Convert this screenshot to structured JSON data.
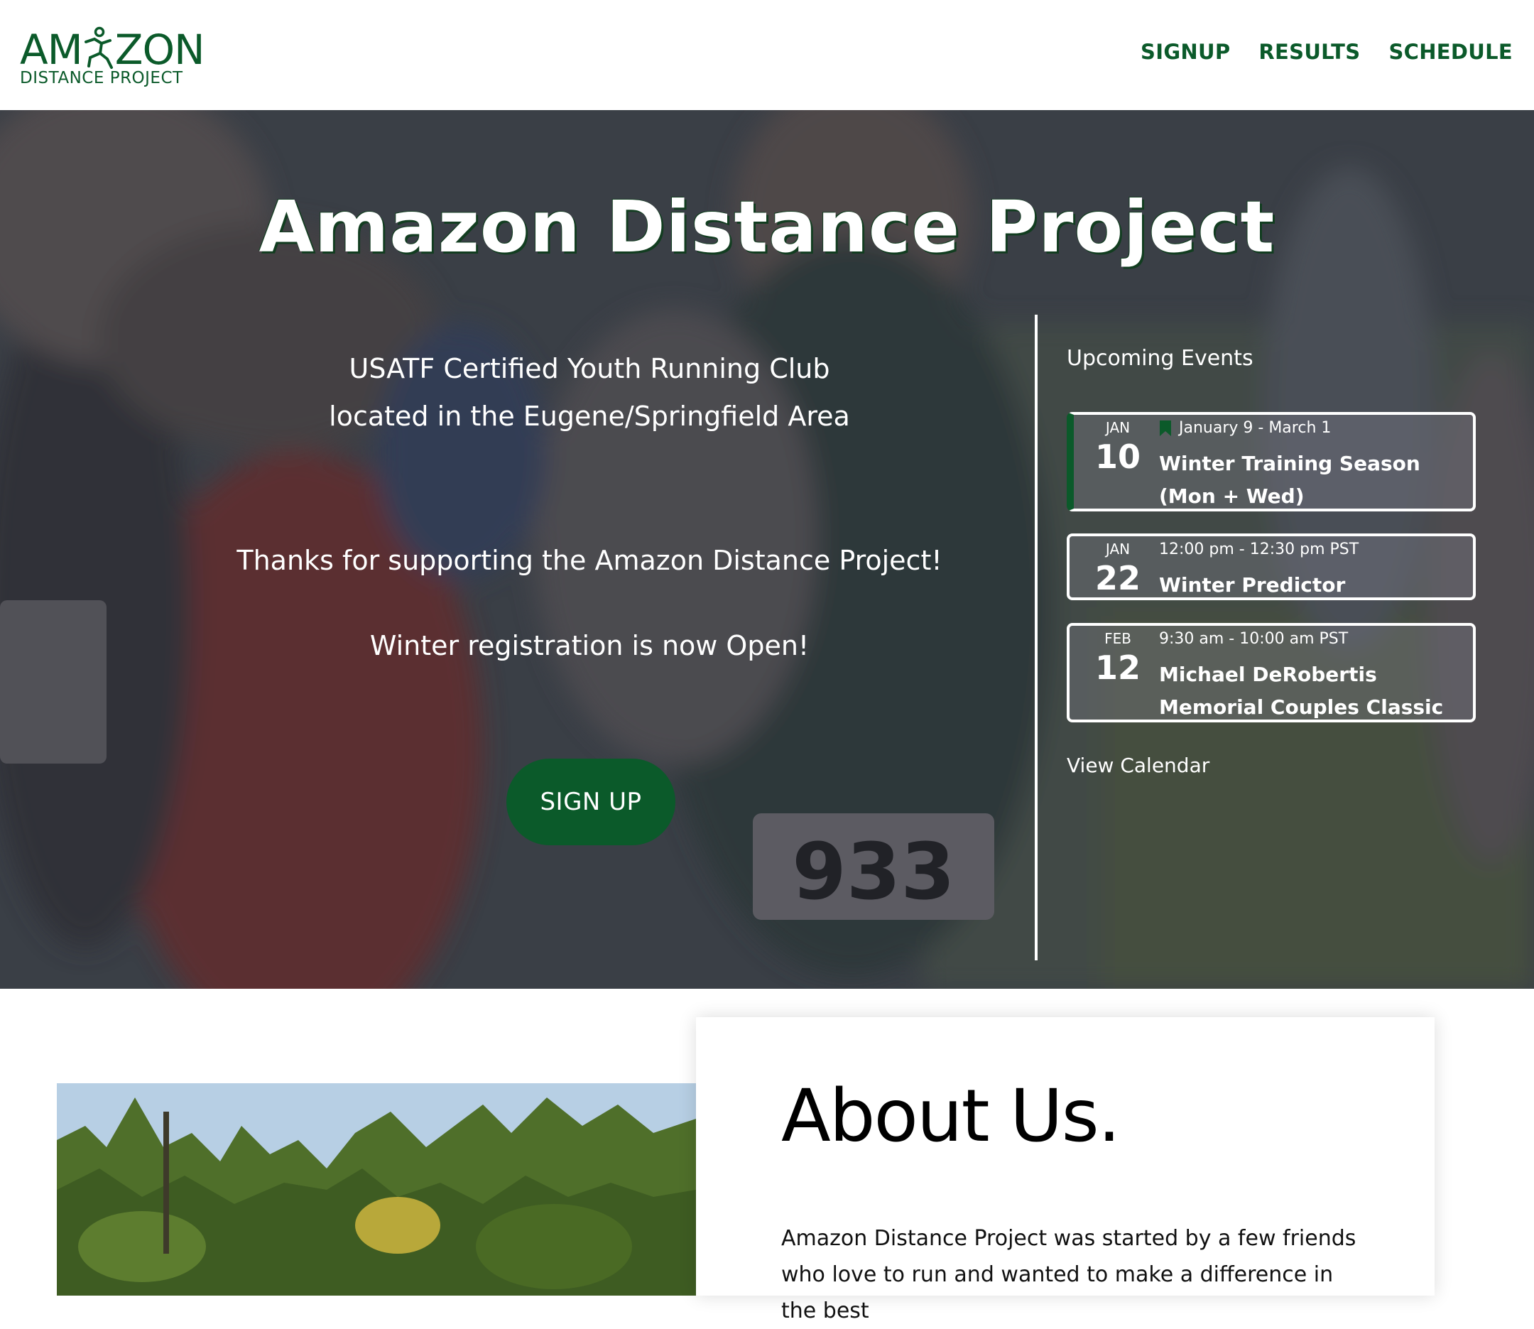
{
  "header": {
    "logo_top": "AM",
    "logo_top_tail": "ZON",
    "logo_bottom": "DISTANCE PROJECT",
    "nav": [
      "SIGNUP",
      "RESULTS",
      "SCHEDULE"
    ]
  },
  "hero": {
    "title": "Amazon Distance Project",
    "subtitle_line1": "USATF Certified Youth Running Club",
    "subtitle_line2": "located in the Eugene/Springfield Area",
    "thanks": "Thanks for supporting the Amazon Distance Project!",
    "registration": "Winter registration is now Open!",
    "signup_label": "SIGN UP"
  },
  "events": {
    "title": "Upcoming Events",
    "items": [
      {
        "month": "JAN",
        "day": "10",
        "time": "January 9 - March 1",
        "name": "Winter Training Season (Mon + Wed)",
        "featured": true
      },
      {
        "month": "JAN",
        "day": "22",
        "time": "12:00 pm - 12:30 pm PST",
        "name": "Winter Predictor",
        "featured": false
      },
      {
        "month": "FEB",
        "day": "12",
        "time": "9:30 am - 10:00 am PST",
        "name": "Michael DeRobertis Memorial Couples Classic",
        "featured": false
      }
    ],
    "view_calendar": "View Calendar"
  },
  "about": {
    "title": "About Us.",
    "text": "Amazon Distance Project was started by a few friends who love to run and wanted to make a difference in the best"
  },
  "colors": {
    "brand_green": "#0b5a2a",
    "hero_overlay": "#40454d",
    "white": "#ffffff"
  },
  "icons": [
    "runner-logo-icon",
    "bookmark-flag-icon"
  ]
}
